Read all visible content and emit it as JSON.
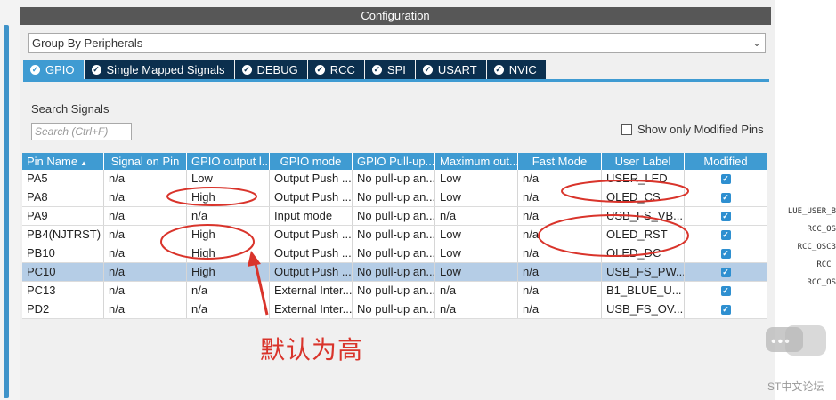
{
  "config_title": "Configuration",
  "group_select": {
    "value": "Group By Peripherals"
  },
  "tabs": [
    {
      "label": "GPIO",
      "active": true
    },
    {
      "label": "Single Mapped Signals"
    },
    {
      "label": "DEBUG"
    },
    {
      "label": "RCC"
    },
    {
      "label": "SPI"
    },
    {
      "label": "USART"
    },
    {
      "label": "NVIC"
    }
  ],
  "search": {
    "label": "Search Signals",
    "placeholder": "Search (Ctrl+F)"
  },
  "show_modified_label": "Show only Modified Pins",
  "table": {
    "headers": [
      "Pin Name",
      "Signal on Pin",
      "GPIO output l...",
      "GPIO mode",
      "GPIO Pull-up...",
      "Maximum out...",
      "Fast Mode",
      "User Label",
      "Modified"
    ],
    "rows": [
      [
        "PA5",
        "n/a",
        "Low",
        "Output Push ...",
        "No pull-up an...",
        "Low",
        "n/a",
        "USER_LED"
      ],
      [
        "PA8",
        "n/a",
        "High",
        "Output Push ...",
        "No pull-up an...",
        "Low",
        "n/a",
        "OLED_CS"
      ],
      [
        "PA9",
        "n/a",
        "n/a",
        "Input mode",
        "No pull-up an...",
        "n/a",
        "n/a",
        "USB_FS_VB..."
      ],
      [
        "PB4(NJTRST)",
        "n/a",
        "High",
        "Output Push ...",
        "No pull-up an...",
        "Low",
        "n/a",
        "OLED_RST"
      ],
      [
        "PB10",
        "n/a",
        "High",
        "Output Push ...",
        "No pull-up an...",
        "Low",
        "n/a",
        "OLED_DC"
      ],
      [
        "PC10",
        "n/a",
        "High",
        "Output Push ...",
        "No pull-up an...",
        "Low",
        "n/a",
        "USB_FS_PW..."
      ],
      [
        "PC13",
        "n/a",
        "n/a",
        "External Inter...",
        "No pull-up an...",
        "n/a",
        "n/a",
        "B1_BLUE_U..."
      ],
      [
        "PD2",
        "n/a",
        "n/a",
        "External Inter...",
        "No pull-up an...",
        "n/a",
        "n/a",
        "USB_FS_OV..."
      ]
    ],
    "selected_row": 5
  },
  "side_labels": [
    "LUE_USER_B",
    "RCC_OS",
    "RCC_OSC3",
    "RCC_",
    "RCC_OS"
  ],
  "annotation_text": "默认为高",
  "watermark_text": "ST中文论坛",
  "colors": {
    "header_blue": "#3f9bd2",
    "tab_dark": "#0b2f4e",
    "selection": "#b5cde6",
    "annotation_red": "#d9342b"
  }
}
